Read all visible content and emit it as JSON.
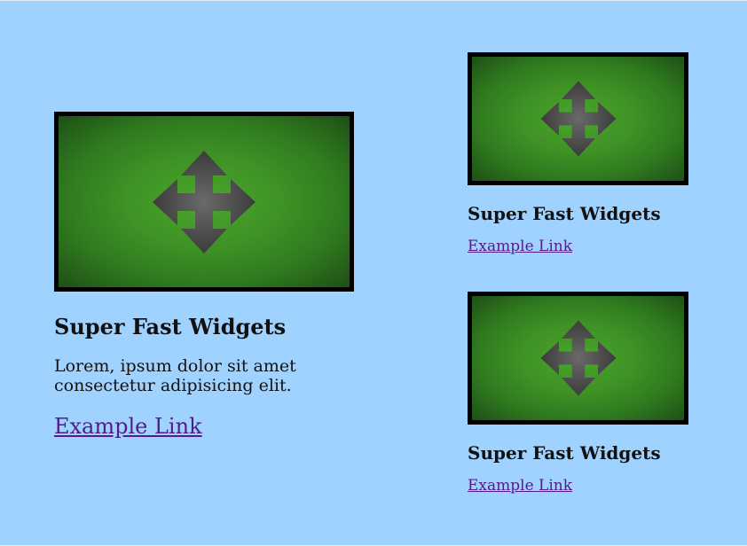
{
  "colors": {
    "page_background": "#a0d2ff",
    "image_frame": "#000000",
    "image_green_center": "#49a62b",
    "image_green_edge": "#1f4f16",
    "arrow_gray": "#4a4a4a",
    "link_visited": "#551a8b"
  },
  "cards": {
    "large": {
      "image_icon": "move-arrows-icon",
      "title": "Super Fast Widgets",
      "body": "Lorem, ipsum dolor sit amet consectetur adipisicing elit.",
      "link": "Example Link"
    },
    "small_1": {
      "image_icon": "move-arrows-icon",
      "title": "Super Fast Widgets",
      "link": "Example Link"
    },
    "small_2": {
      "image_icon": "move-arrows-icon",
      "title": "Super Fast Widgets",
      "link": "Example Link"
    }
  }
}
